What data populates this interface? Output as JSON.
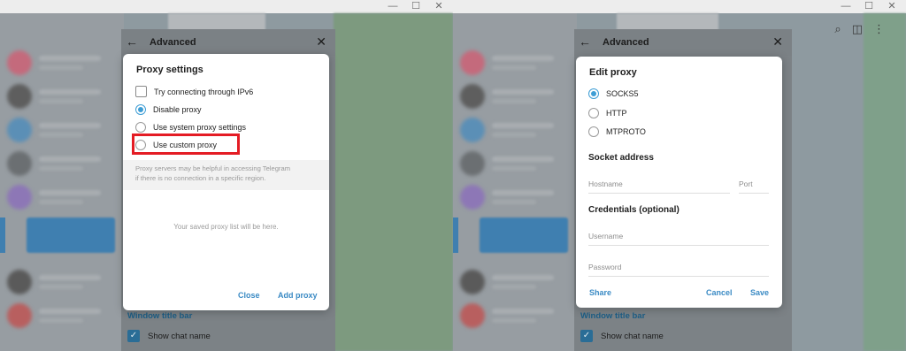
{
  "window_controls": {
    "minimize": "—",
    "maximize": "☐",
    "close": "✕"
  },
  "settings_panel": {
    "back_icon": "←",
    "title": "Advanced",
    "close_icon": "✕",
    "section_title": "Window title bar",
    "show_chat_name_label": "Show chat name",
    "show_chat_name_checked": true
  },
  "top_icons": {
    "search": "⌕",
    "columns": "◫",
    "more": "⋮"
  },
  "proxy_dialog": {
    "title": "Proxy settings",
    "options": {
      "try_ipv6": {
        "label": "Try connecting through IPv6",
        "checked": false
      },
      "disable_proxy": {
        "label": "Disable proxy",
        "selected": true
      },
      "system_proxy": {
        "label": "Use system proxy settings",
        "selected": false
      },
      "custom_proxy": {
        "label": "Use custom proxy",
        "selected": false
      }
    },
    "info_line1": "Proxy servers may be helpful in accessing Telegram",
    "info_line2": "if there is no connection in a specific region.",
    "empty_message": "Your saved proxy list will be here.",
    "close_label": "Close",
    "add_label": "Add proxy"
  },
  "edit_proxy_dialog": {
    "title": "Edit proxy",
    "types": [
      {
        "label": "SOCKS5",
        "selected": true
      },
      {
        "label": "HTTP",
        "selected": false
      },
      {
        "label": "MTPROTO",
        "selected": false
      }
    ],
    "socket_title": "Socket address",
    "hostname_placeholder": "Hostname",
    "port_placeholder": "Port",
    "credentials_title": "Credentials (optional)",
    "username_placeholder": "Username",
    "password_placeholder": "Password",
    "share_label": "Share",
    "cancel_label": "Cancel",
    "save_label": "Save"
  },
  "colors": {
    "accent": "#3d9dd5",
    "link": "#3a8ac4",
    "highlight": "#e41c24"
  }
}
